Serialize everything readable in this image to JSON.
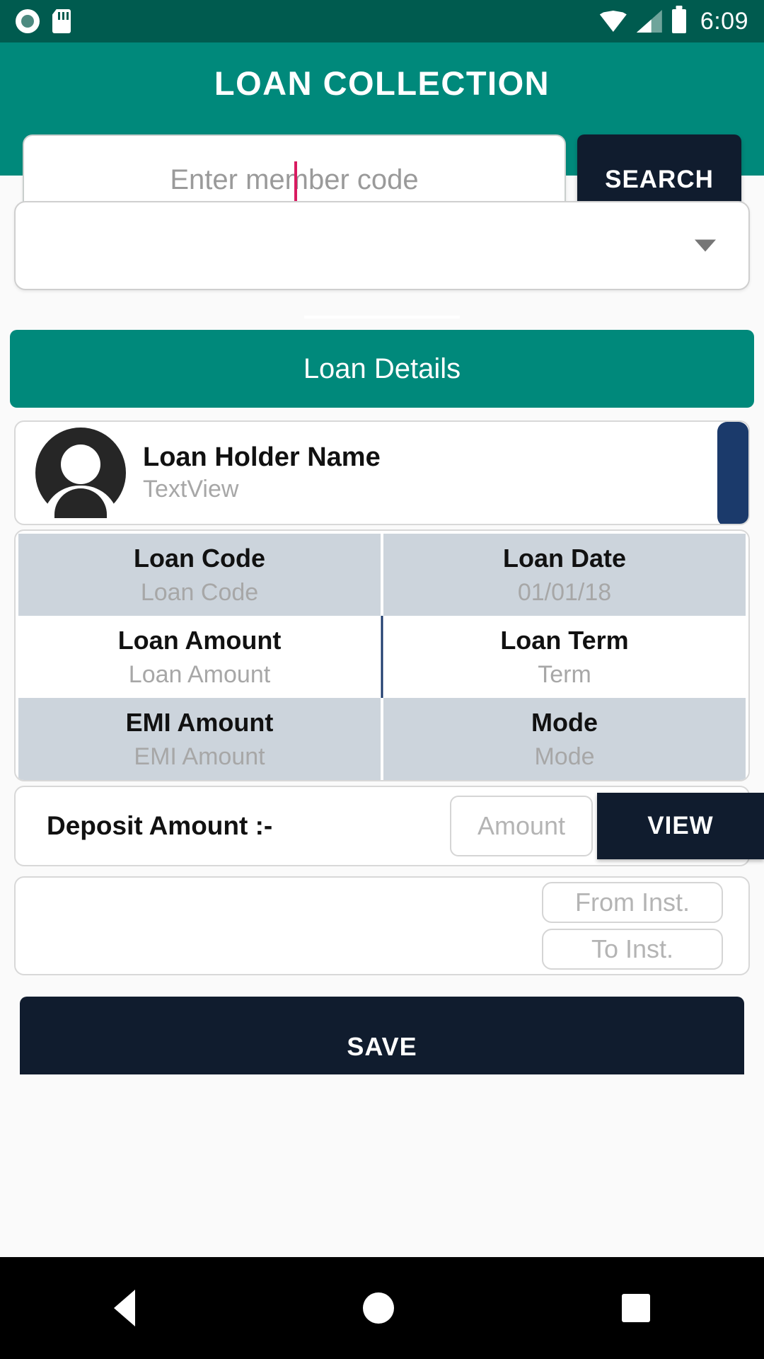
{
  "status_bar": {
    "time": "6:09",
    "icons": [
      "record-icon",
      "sd-card-icon",
      "wifi-icon",
      "cellular-signal-icon",
      "battery-icon"
    ]
  },
  "app_bar": {
    "title": "LOAN COLLECTION",
    "background": "#00897b"
  },
  "search": {
    "placeholder": "Enter member code",
    "value": "",
    "button_label": "SEARCH",
    "button_color": "#101c2e",
    "caret_color": "#d81b60"
  },
  "member_spinner": {
    "selected_value": "",
    "arrow_icon": "chevron-down-icon"
  },
  "loan_details_banner": {
    "title": "Loan Details"
  },
  "holder": {
    "name": "Loan Holder Name",
    "subtitle": "TextView",
    "avatar_icon": "person-avatar-icon",
    "accent_color": "#1b3a6b"
  },
  "detail_grid": {
    "rows": [
      {
        "shaded": true,
        "cells": [
          {
            "label": "Loan Code",
            "value": "Loan Code"
          },
          {
            "label": "Loan Date",
            "value": "01/01/18"
          }
        ]
      },
      {
        "shaded": false,
        "cells": [
          {
            "label": "Loan Amount",
            "value": "Loan Amount"
          },
          {
            "label": "Loan Term",
            "value": "Term"
          }
        ]
      },
      {
        "shaded": true,
        "cells": [
          {
            "label": "EMI Amount",
            "value": "EMI Amount"
          },
          {
            "label": "Mode",
            "value": "Mode"
          }
        ]
      }
    ]
  },
  "deposit": {
    "label": "Deposit Amount :-",
    "amount_placeholder": "Amount",
    "amount_value": "",
    "view_label": "VIEW"
  },
  "installment": {
    "from_placeholder": "From Inst.",
    "from_value": "",
    "to_placeholder": "To Inst.",
    "to_value": ""
  },
  "save": {
    "label": "SAVE"
  },
  "nav_bar": {
    "back": "back-triangle-icon",
    "home": "home-circle-icon",
    "recent": "recent-square-icon"
  }
}
